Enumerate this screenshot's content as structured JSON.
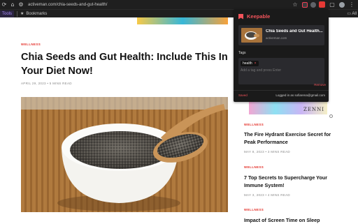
{
  "browser": {
    "url": "activeman.com/chia-seeds-and-gut-health/",
    "bookmarks_bar": {
      "apps_label": "Tools",
      "bookmarks_label": "Bookmarks",
      "all_bookmarks_label": "All"
    },
    "icons": [
      "back-icon",
      "home-icon",
      "site-info-icon",
      "star-icon",
      "pocket-icon",
      "extension-icon",
      "keepable-icon",
      "profile-icon",
      "menu-icon",
      "bookmark-star-icon",
      "folder-icon"
    ]
  },
  "article": {
    "category": "WELLNESS",
    "title": "Chia Seeds and Gut Health: Include This In Your Diet Now!",
    "meta": "APRIL 29, 2023 • 5 MINS READ"
  },
  "sidebar": {
    "ad_text": "ZENNI",
    "posts": [
      {
        "category": "WELLNESS",
        "title": "The Fire Hydrant Exercise Secret for Peak Performance",
        "meta": "MAY 8, 2023 • 3 MINS READ"
      },
      {
        "category": "WELLNESS",
        "title": "7 Top Secrets to Supercharge Your Immune System!",
        "meta": "MAY 3, 2023 • 4 MINS READ"
      },
      {
        "category": "WELLNESS",
        "title": "Impact of Screen Time on Sleep"
      }
    ]
  },
  "popup": {
    "brand": "Keepable",
    "card": {
      "title": "Chia Seeds and Gut Health...",
      "url": "activeman.com"
    },
    "tags_label": "Tags",
    "tags": [
      {
        "label": "health",
        "remove": "×"
      }
    ],
    "tag_input_placeholder": "Add a tag and press Enter",
    "remove_label": "Remove",
    "saved_label": "Saved",
    "logged_in_text": "Logged in as sofiarena@gmail.com"
  },
  "colors": {
    "accent": "#e4322b",
    "keepable": "#f2545b",
    "chrome": "#1f1f1f"
  }
}
